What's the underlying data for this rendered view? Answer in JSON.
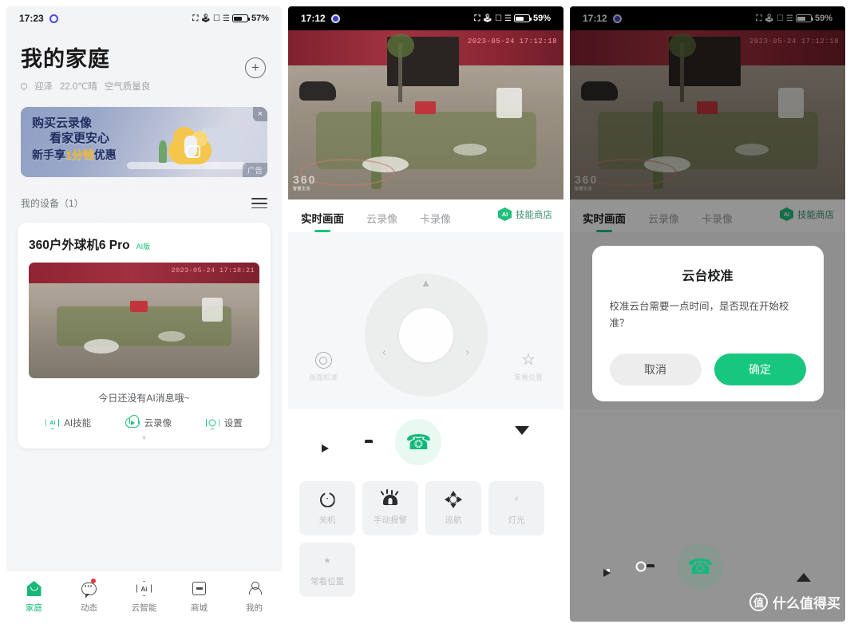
{
  "panel1": {
    "status": {
      "time": "17:23",
      "battery": "57%",
      "icons": [
        "nfc-icon",
        "bluetooth-icon",
        "vibrate-icon",
        "signal-icon",
        "battery-icon"
      ]
    },
    "header": {
      "title": "我的家庭",
      "add_label": "+",
      "location": "迎泽",
      "temperature": "22.0℃晴",
      "air": "空气质量良"
    },
    "ad": {
      "line1": "购买云录像",
      "line2": "看家更安心",
      "line3_a": "新手享",
      "line3_b": "1分钱",
      "line3_c": "优惠",
      "tag": "广告",
      "close": "×"
    },
    "devices": {
      "header": "我的设备（1）"
    },
    "card": {
      "name": "360户外球机6 Pro",
      "badge": "AI版",
      "thumb_timestamp": "2023-05-24 17:18:21",
      "no_message": "今日还没有AI消息哦~",
      "actions": [
        {
          "label": "AI技能",
          "icon": "ai-skill-icon",
          "glyph": "Ai"
        },
        {
          "label": "云录像",
          "icon": "cloud-record-icon"
        },
        {
          "label": "设置",
          "icon": "settings-icon"
        }
      ]
    },
    "tabbar": [
      {
        "label": "家庭",
        "icon": "home-icon",
        "active": true,
        "badge": false
      },
      {
        "label": "动态",
        "icon": "chat-icon",
        "active": false,
        "badge": true
      },
      {
        "label": "云智能",
        "icon": "ai-icon",
        "active": false,
        "badge": false
      },
      {
        "label": "商城",
        "icon": "shop-icon",
        "active": false,
        "badge": false
      },
      {
        "label": "我的",
        "icon": "user-icon",
        "active": false,
        "badge": false
      }
    ]
  },
  "panel2": {
    "status": {
      "time": "17:12",
      "battery": "59%"
    },
    "video": {
      "timestamp": "2023-05-24 17:12:18",
      "watermark": "360",
      "watermark_sub": "智慧生活"
    },
    "tabs": [
      {
        "label": "实时画面",
        "active": true
      },
      {
        "label": "云录像",
        "active": false
      },
      {
        "label": "卡录像",
        "active": false
      }
    ],
    "skill_store": {
      "label": "技能商店",
      "glyph": "AI"
    },
    "ptz": {
      "up": "▲",
      "left": "‹",
      "right": "›",
      "left_btn_label": "画面校准",
      "right_btn_label": "常看位置"
    },
    "actions": [
      {
        "name": "record-button",
        "icon": "video-camera-icon"
      },
      {
        "name": "snapshot-button",
        "icon": "camera-icon"
      },
      {
        "name": "talk-button",
        "icon": "phone-icon"
      },
      {
        "name": "speaker-button",
        "icon": "speaker-icon"
      },
      {
        "name": "collapse-button",
        "icon": "chevron-down-icon"
      }
    ],
    "tiles": [
      {
        "label": "关机",
        "icon": "power-icon"
      },
      {
        "label": "手动报警",
        "icon": "alarm-icon"
      },
      {
        "label": "巡航",
        "icon": "cruise-icon"
      },
      {
        "label": "灯光",
        "icon": "light-icon"
      },
      {
        "label": "常看位置",
        "icon": "star-check-icon"
      }
    ]
  },
  "panel3": {
    "status": {
      "time": "17:12",
      "battery": "59%"
    },
    "video": {
      "timestamp": "2023-05-24 17:12:18",
      "watermark": "360",
      "watermark_sub": "智慧生活"
    },
    "tabs": [
      {
        "label": "实时画面",
        "active": true
      },
      {
        "label": "云录像",
        "active": false
      },
      {
        "label": "卡录像",
        "active": false
      }
    ],
    "skill_store": {
      "label": "技能商店",
      "glyph": "AI"
    },
    "dialog": {
      "title": "云台校准",
      "message": "校准云台需要一点时间，是否现在开始校准？",
      "cancel": "取消",
      "confirm": "确定"
    },
    "actions": [
      {
        "name": "record-button",
        "icon": "video-camera-icon"
      },
      {
        "name": "snapshot-button",
        "icon": "camera-icon"
      },
      {
        "name": "talk-button",
        "icon": "phone-icon"
      },
      {
        "name": "speaker-button",
        "icon": "speaker-icon"
      },
      {
        "name": "expand-button",
        "icon": "chevron-up-icon"
      }
    ],
    "watermark": {
      "badge": "值",
      "text": "什么值得买"
    }
  },
  "colors": {
    "brand_green": "#17c77f",
    "accent_green": "#19c37d",
    "badge_red": "#f4333c",
    "ad_gold": "#f2b21c"
  }
}
